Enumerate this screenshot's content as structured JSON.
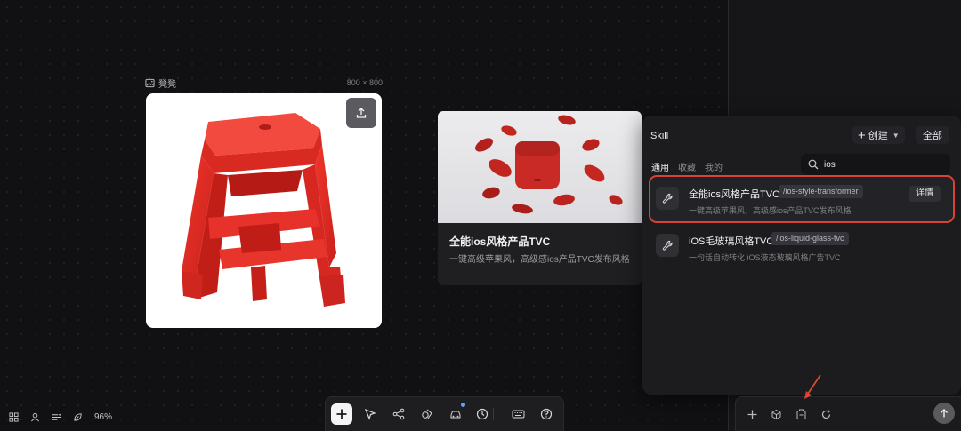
{
  "canvas": {
    "image_node": {
      "label": "凳凳",
      "size": "800 × 800"
    }
  },
  "product_card": {
    "title": "全能ios风格产品TVC",
    "desc": "一键高级苹果风，高级感ios产品TVC发布风格"
  },
  "skill_panel": {
    "title": "Skill",
    "create_label": "创建",
    "all_label": "全部",
    "tabs": [
      "通用",
      "收藏",
      "我的"
    ],
    "search_value": "ios",
    "items": [
      {
        "name": "全能ios风格产品TVC",
        "slug": "/ios-style-transformer",
        "desc": "一键高级苹果风，高级感ios产品TVC发布风格",
        "detail_label": "详情"
      },
      {
        "name": "iOS毛玻璃风格TVC",
        "slug": "/ios-liquid-glass-tvc",
        "desc": "一句话自动转化 iOS液态玻璃风格广告TVC"
      }
    ]
  },
  "status": {
    "zoom": "96%"
  },
  "colors": {
    "highlight": "#d74436",
    "accent_dot": "#58a6ff",
    "stool_red": "#e02a22",
    "background": "#111113"
  },
  "icons": {
    "toolbar": [
      "plus-icon",
      "cursor-icon",
      "share-nodes-icon",
      "shapes-icon",
      "car-icon",
      "clock-icon",
      "keyboard-icon",
      "help-icon"
    ],
    "status": [
      "grid-icon",
      "user-icon",
      "layers-icon",
      "leaf-icon"
    ],
    "composer": [
      "plus-icon",
      "cube-icon",
      "clip-icon",
      "refresh-icon",
      "arrow-up-icon"
    ]
  }
}
